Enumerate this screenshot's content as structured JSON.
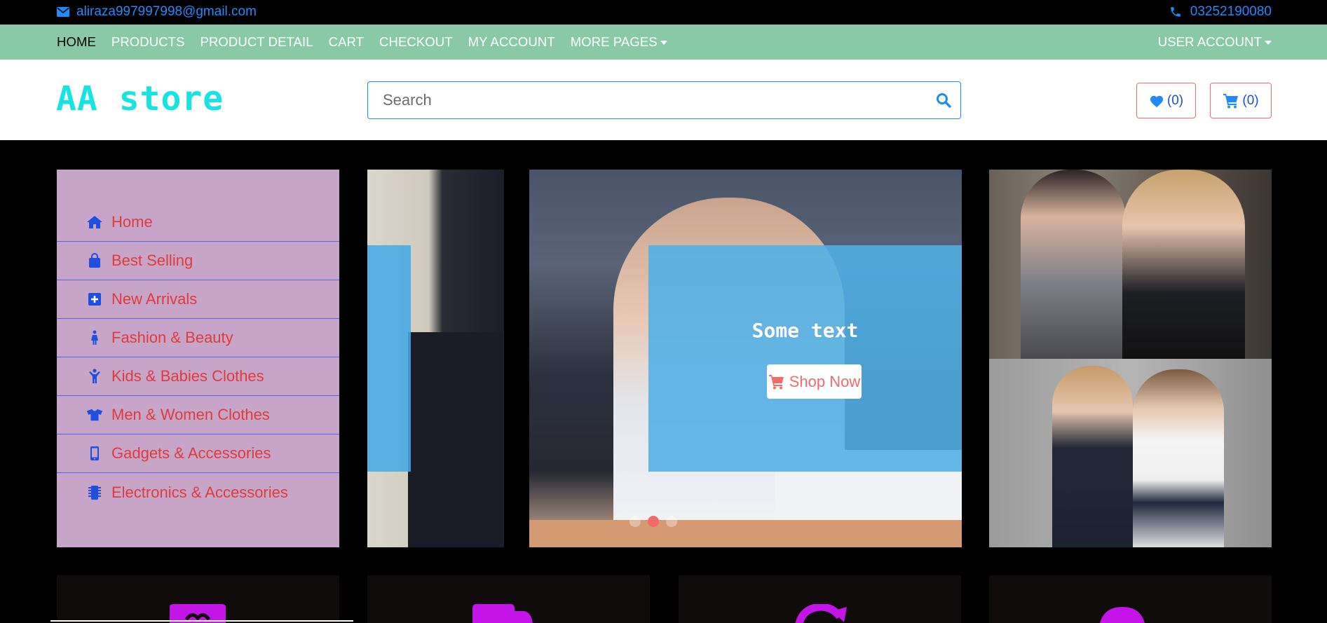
{
  "topbar": {
    "email": "aliraza997997998@gmail.com",
    "phone": "03252190080",
    "email_icon": "envelope-icon",
    "phone_icon": "phone-icon"
  },
  "nav": {
    "links": [
      "HOME",
      "PRODUCTS",
      "PRODUCT DETAIL",
      "CART",
      "CHECKOUT",
      "MY ACCOUNT",
      "MORE PAGES"
    ],
    "active": "HOME",
    "account": "USER ACCOUNT"
  },
  "header": {
    "logo": "AA store",
    "search_placeholder": "Search",
    "wishlist_count": "(0)",
    "cart_count": "(0)"
  },
  "sidebar": {
    "items": [
      {
        "label": "Home",
        "icon": "home-icon"
      },
      {
        "label": "Best Selling",
        "icon": "shopping-bag-icon"
      },
      {
        "label": "New Arrivals",
        "icon": "plus-square-icon"
      },
      {
        "label": "Fashion & Beauty",
        "icon": "female-icon"
      },
      {
        "label": "Kids & Babies Clothes",
        "icon": "child-icon"
      },
      {
        "label": "Men & Women Clothes",
        "icon": "tshirt-icon"
      },
      {
        "label": "Gadgets & Accessories",
        "icon": "mobile-icon"
      },
      {
        "label": "Electronics & Accessories",
        "icon": "microchip-icon"
      }
    ]
  },
  "slider": {
    "caption": "Some text",
    "button": "Shop Now",
    "active_slide": 2,
    "slide_count": 3
  },
  "colors": {
    "accent_blue": "#1e8bff",
    "nav_green": "#89c9a5",
    "logo_cyan": "#18e3e3",
    "sidebar_bg": "#c6a5c9",
    "sidebar_text": "#e23a3a",
    "overlay_blue": "#50afe6",
    "feature_icon": "#c414e8"
  }
}
